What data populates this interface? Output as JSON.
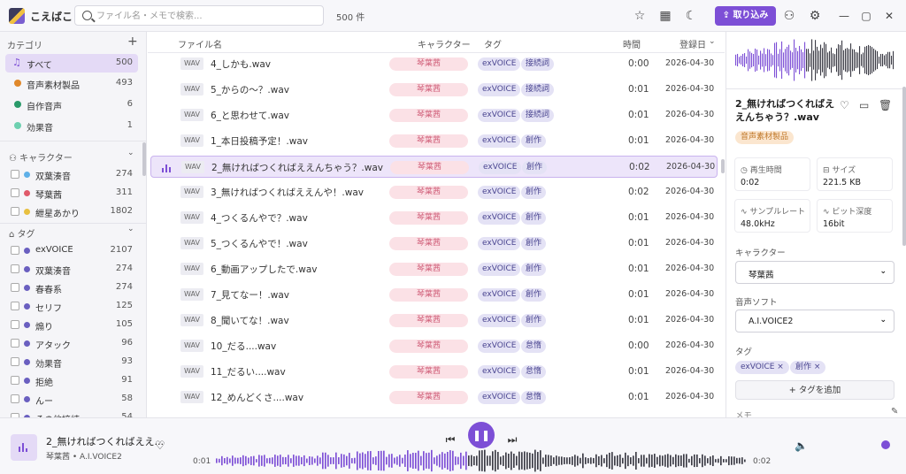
{
  "app": {
    "name": "こえばこ",
    "search_placeholder": "ファイル名・メモで検索...",
    "count": "500 件",
    "import_label": "取り込み"
  },
  "colors": {
    "accent": "#7d4fd6",
    "chara_pink": "#d0607a",
    "tag_bg": "#e4e2f5"
  },
  "icons": {
    "star": "star-icon",
    "grid": "grid-icon",
    "moon": "moon-icon",
    "users": "users-icon",
    "gear": "gear-icon"
  },
  "sidebar": {
    "category_header": "カテゴリ",
    "categories": [
      {
        "label": "すべて",
        "count": "500",
        "color": "#7d4fd6"
      },
      {
        "label": "音声素材製品",
        "count": "493",
        "color": "#e0882a"
      },
      {
        "label": "自作音声",
        "count": "6",
        "color": "#2a9a6a"
      },
      {
        "label": "効果音",
        "count": "1",
        "color": "#6dd0b0"
      }
    ],
    "character_header": "キャラクター",
    "characters": [
      {
        "label": "双葉湊音",
        "count": "274",
        "color": "#5fb0e8"
      },
      {
        "label": "琴葉茜",
        "count": "311",
        "color": "#e05a6a"
      },
      {
        "label": "紲星あかり",
        "count": "1802",
        "color": "#e8c040"
      }
    ],
    "tag_header": "タグ",
    "tags": [
      {
        "label": "exVOICE",
        "count": "2107"
      },
      {
        "label": "双葉湊音",
        "count": "274"
      },
      {
        "label": "春春系",
        "count": "274"
      },
      {
        "label": "セリフ",
        "count": "125"
      },
      {
        "label": "煽り",
        "count": "105"
      },
      {
        "label": "アタック",
        "count": "96"
      },
      {
        "label": "効果音",
        "count": "93"
      },
      {
        "label": "拒絶",
        "count": "91"
      },
      {
        "label": "んー",
        "count": "58"
      },
      {
        "label": "その他接続",
        "count": "54"
      }
    ]
  },
  "list": {
    "headers": {
      "file": "ファイル名",
      "chara": "キャラクター",
      "tag": "タグ",
      "time": "時間",
      "date": "登録日"
    },
    "rows": [
      {
        "type": "WAV",
        "name": "4_しかも.wav",
        "chara": "琴葉茜",
        "tags": [
          "exVOICE",
          "接続詞"
        ],
        "time": "0:00",
        "date": "2026-04-30"
      },
      {
        "type": "WAV",
        "name": "5_からの～？.wav",
        "chara": "琴葉茜",
        "tags": [
          "exVOICE",
          "接続詞"
        ],
        "time": "0:01",
        "date": "2026-04-30"
      },
      {
        "type": "WAV",
        "name": "6_と思わせて.wav",
        "chara": "琴葉茜",
        "tags": [
          "exVOICE",
          "接続詞"
        ],
        "time": "0:01",
        "date": "2026-04-30"
      },
      {
        "type": "WAV",
        "name": "1_本日投稿予定！.wav",
        "chara": "琴葉茜",
        "tags": [
          "exVOICE",
          "創作"
        ],
        "time": "0:01",
        "date": "2026-04-30"
      },
      {
        "type": "WAV",
        "name": "2_無ければつくればええんちゃう？.wav",
        "chara": "琴葉茜",
        "tags": [
          "exVOICE",
          "創作"
        ],
        "time": "0:02",
        "date": "2026-04-30",
        "selected": true
      },
      {
        "type": "WAV",
        "name": "3_無ければつくればええんや！.wav",
        "chara": "琴葉茜",
        "tags": [
          "exVOICE",
          "創作"
        ],
        "time": "0:02",
        "date": "2026-04-30"
      },
      {
        "type": "WAV",
        "name": "4_つくるんやで？.wav",
        "chara": "琴葉茜",
        "tags": [
          "exVOICE",
          "創作"
        ],
        "time": "0:01",
        "date": "2026-04-30"
      },
      {
        "type": "WAV",
        "name": "5_つくるんやで！.wav",
        "chara": "琴葉茜",
        "tags": [
          "exVOICE",
          "創作"
        ],
        "time": "0:01",
        "date": "2026-04-30"
      },
      {
        "type": "WAV",
        "name": "6_動画アップしたで.wav",
        "chara": "琴葉茜",
        "tags": [
          "exVOICE",
          "創作"
        ],
        "time": "0:01",
        "date": "2026-04-30"
      },
      {
        "type": "WAV",
        "name": "7_見てなー！.wav",
        "chara": "琴葉茜",
        "tags": [
          "exVOICE",
          "創作"
        ],
        "time": "0:01",
        "date": "2026-04-30"
      },
      {
        "type": "WAV",
        "name": "8_聞いてな！.wav",
        "chara": "琴葉茜",
        "tags": [
          "exVOICE",
          "創作"
        ],
        "time": "0:01",
        "date": "2026-04-30"
      },
      {
        "type": "WAV",
        "name": "10_だる....wav",
        "chara": "琴葉茜",
        "tags": [
          "exVOICE",
          "怠惰"
        ],
        "time": "0:00",
        "date": "2026-04-30"
      },
      {
        "type": "WAV",
        "name": "11_だるい....wav",
        "chara": "琴葉茜",
        "tags": [
          "exVOICE",
          "怠惰"
        ],
        "time": "0:01",
        "date": "2026-04-30"
      },
      {
        "type": "WAV",
        "name": "12_めんどくさ....wav",
        "chara": "琴葉茜",
        "tags": [
          "exVOICE",
          "怠惰"
        ],
        "time": "0:01",
        "date": "2026-04-30"
      }
    ]
  },
  "detail": {
    "title": "2_無ければつくればええんちゃう？.wav",
    "category": "音声素材製品",
    "duration_label": "再生時間",
    "duration": "0:02",
    "size_label": "サイズ",
    "size": "221.5 KB",
    "rate_label": "サンプルレート",
    "rate": "48.0kHz",
    "depth_label": "ビット深度",
    "depth": "16bit",
    "chara_label": "キャラクター",
    "chara_value": "琴葉茜",
    "soft_label": "音声ソフト",
    "soft_value": "A.I.VOICE2",
    "tag_label": "タグ",
    "tags": [
      "exVOICE",
      "創作"
    ],
    "add_tag": "+ タグを追加",
    "memo_label": "メモ"
  },
  "player": {
    "title": "2_無ければつくればええ...",
    "sub": "琴葉茜 • A.I.VOICE2",
    "current": "0:01",
    "total": "0:02"
  }
}
